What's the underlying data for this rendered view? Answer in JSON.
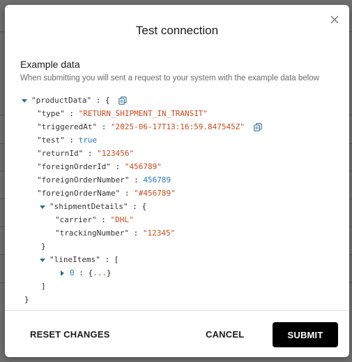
{
  "dialog": {
    "title": "Test connection",
    "section_heading": "Example data",
    "section_description": "When submitting you will sent a request to your system with the example data below"
  },
  "json_view": {
    "root_key": "\"productData\"",
    "type_key": "\"type\"",
    "type_value": "\"RETURN_SHIPMENT_IN_TRANSIT\"",
    "triggered_key": "\"triggeredAt\"",
    "triggered_value": "\"2025-06-17T13:16:59.847545Z\"",
    "test_key": "\"test\"",
    "test_value": "true",
    "return_id_key": "\"returnId\"",
    "return_id_value": "\"123456\"",
    "foreign_order_id_key": "\"foreignOrderId\"",
    "foreign_order_id_value": "\"456789\"",
    "foreign_order_number_key": "\"foreignOrderNumber\"",
    "foreign_order_number_value": "456789",
    "foreign_order_name_key": "\"foreignOrderName\"",
    "foreign_order_name_value": "\"#456789\"",
    "shipment_details_key": "\"shipmentDetails\"",
    "carrier_key": "\"carrier\"",
    "carrier_value": "\"DHL\"",
    "tracking_key": "\"trackingNumber\"",
    "tracking_value": "\"12345\"",
    "line_items_key": "\"lineItems\"",
    "line_item_index": "0",
    "collapsed_ellipsis": "...",
    "colon": ":",
    "open_brace": "{",
    "close_brace": "}",
    "open_bracket": "[",
    "close_bracket": "]"
  },
  "footer": {
    "reset_label": "RESET CHANGES",
    "cancel_label": "CANCEL",
    "submit_label": "SUBMIT"
  },
  "colors": {
    "string": "#c8491d",
    "number": "#2a7ab0",
    "submit_bg": "#000000"
  },
  "icons": {
    "close": "close-icon",
    "copy": "copy-icon",
    "expand": "caret-down-icon",
    "collapse": "caret-right-icon"
  }
}
